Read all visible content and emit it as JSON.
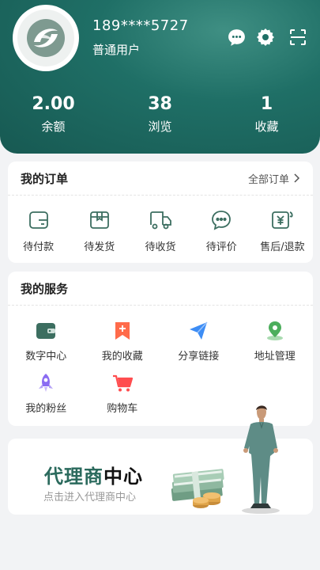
{
  "header": {
    "phone": "189****5727",
    "role": "普通用户",
    "icons": [
      "chat-icon",
      "gear-icon",
      "scan-icon"
    ],
    "stats": [
      {
        "value": "2.00",
        "label": "余额"
      },
      {
        "value": "38",
        "label": "浏览"
      },
      {
        "value": "1",
        "label": "收藏"
      }
    ]
  },
  "orders": {
    "title": "我的订单",
    "all_label": "全部订单",
    "items": [
      {
        "label": "待付款",
        "icon": "wallet-icon"
      },
      {
        "label": "待发货",
        "icon": "package-icon"
      },
      {
        "label": "待收货",
        "icon": "truck-icon"
      },
      {
        "label": "待评价",
        "icon": "comment-icon"
      },
      {
        "label": "售后/退款",
        "icon": "refund-icon"
      }
    ]
  },
  "services": {
    "title": "我的服务",
    "items": [
      {
        "label": "数字中心",
        "icon": "wallet-icon",
        "color": "#3c6e60"
      },
      {
        "label": "我的收藏",
        "icon": "bookmark-icon",
        "color": "#ff6b4a"
      },
      {
        "label": "分享链接",
        "icon": "send-icon",
        "color": "#3d8df5"
      },
      {
        "label": "地址管理",
        "icon": "location-icon",
        "color": "#4cae5c"
      },
      {
        "label": "我的粉丝",
        "icon": "rocket-icon",
        "color": "#8b6cf2"
      },
      {
        "label": "购物车",
        "icon": "cart-icon",
        "color": "#ff4d4f"
      }
    ]
  },
  "agent": {
    "title_part1": "代理商",
    "title_part2": "中心",
    "subtitle": "点击进入代理商中心"
  },
  "colors": {
    "header": "#1f6f66",
    "accent": "#2b6a5d"
  }
}
